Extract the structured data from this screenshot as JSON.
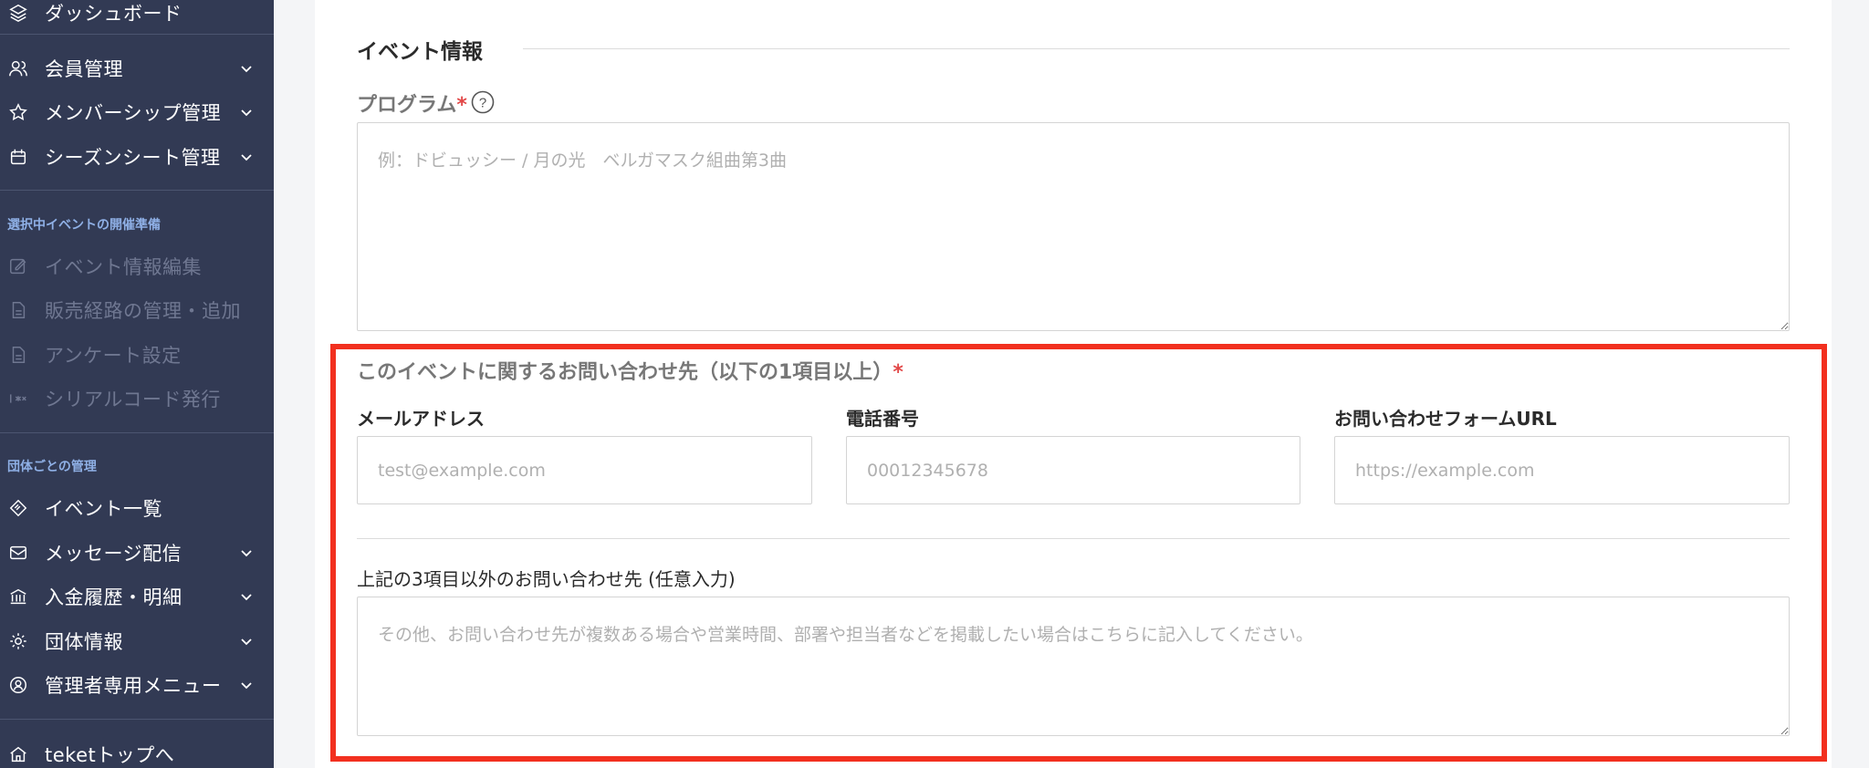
{
  "sidebar": {
    "items": [
      {
        "label": "ダッシュボード",
        "icon": "layers-icon",
        "chevron": false,
        "disabled": false
      },
      {
        "label": "会員管理",
        "icon": "users-icon",
        "chevron": true,
        "disabled": false
      },
      {
        "label": "メンバーシップ管理",
        "icon": "star-icon",
        "chevron": true,
        "disabled": false
      },
      {
        "label": "シーズンシート管理",
        "icon": "calendar-icon",
        "chevron": true,
        "disabled": false
      }
    ],
    "section1_title": "選択中イベントの開催準備",
    "section1_items": [
      {
        "label": "イベント情報編集",
        "icon": "edit-icon",
        "disabled": true
      },
      {
        "label": "販売経路の管理・追加",
        "icon": "document-icon",
        "disabled": true
      },
      {
        "label": "アンケート設定",
        "icon": "document-icon",
        "disabled": true
      },
      {
        "label": "シリアルコード発行",
        "icon": "serial-code-icon",
        "disabled": true
      }
    ],
    "section2_title": "団体ごとの管理",
    "section2_items": [
      {
        "label": "イベント一覧",
        "icon": "ticket-icon",
        "chevron": false
      },
      {
        "label": "メッセージ配信",
        "icon": "mail-icon",
        "chevron": true
      },
      {
        "label": "入金履歴・明細",
        "icon": "bank-icon",
        "chevron": true
      },
      {
        "label": "団体情報",
        "icon": "gear-icon",
        "chevron": true
      },
      {
        "label": "管理者専用メニュー",
        "icon": "admin-icon",
        "chevron": true
      }
    ],
    "top_link": "teketトップへ"
  },
  "main": {
    "section_heading": "イベント情報",
    "program": {
      "label": "プログラム",
      "required_mark": "*",
      "placeholder": "例：ドビュッシー / 月の光　ベルガマスク組曲第3曲"
    },
    "contact": {
      "title": "このイベントに関するお問い合わせ先（以下の1項目以上）",
      "required_mark": "*",
      "email": {
        "label": "メールアドレス",
        "placeholder": "test@example.com"
      },
      "phone": {
        "label": "電話番号",
        "placeholder": "00012345678"
      },
      "form_url": {
        "label": "お問い合わせフォームURL",
        "placeholder": "https://example.com"
      },
      "other": {
        "label": "上記の3項目以外のお問い合わせ先 (任意入力)",
        "placeholder": "その他、お問い合わせ先が複数ある場合や営業時間、部署や担当者などを掲載したい場合はこちらに記入してください。"
      }
    }
  },
  "colors": {
    "sidebar_bg": "#323a54",
    "section_title": "#8fb0e6",
    "required": "#e24848",
    "highlight": "#f2301f"
  }
}
